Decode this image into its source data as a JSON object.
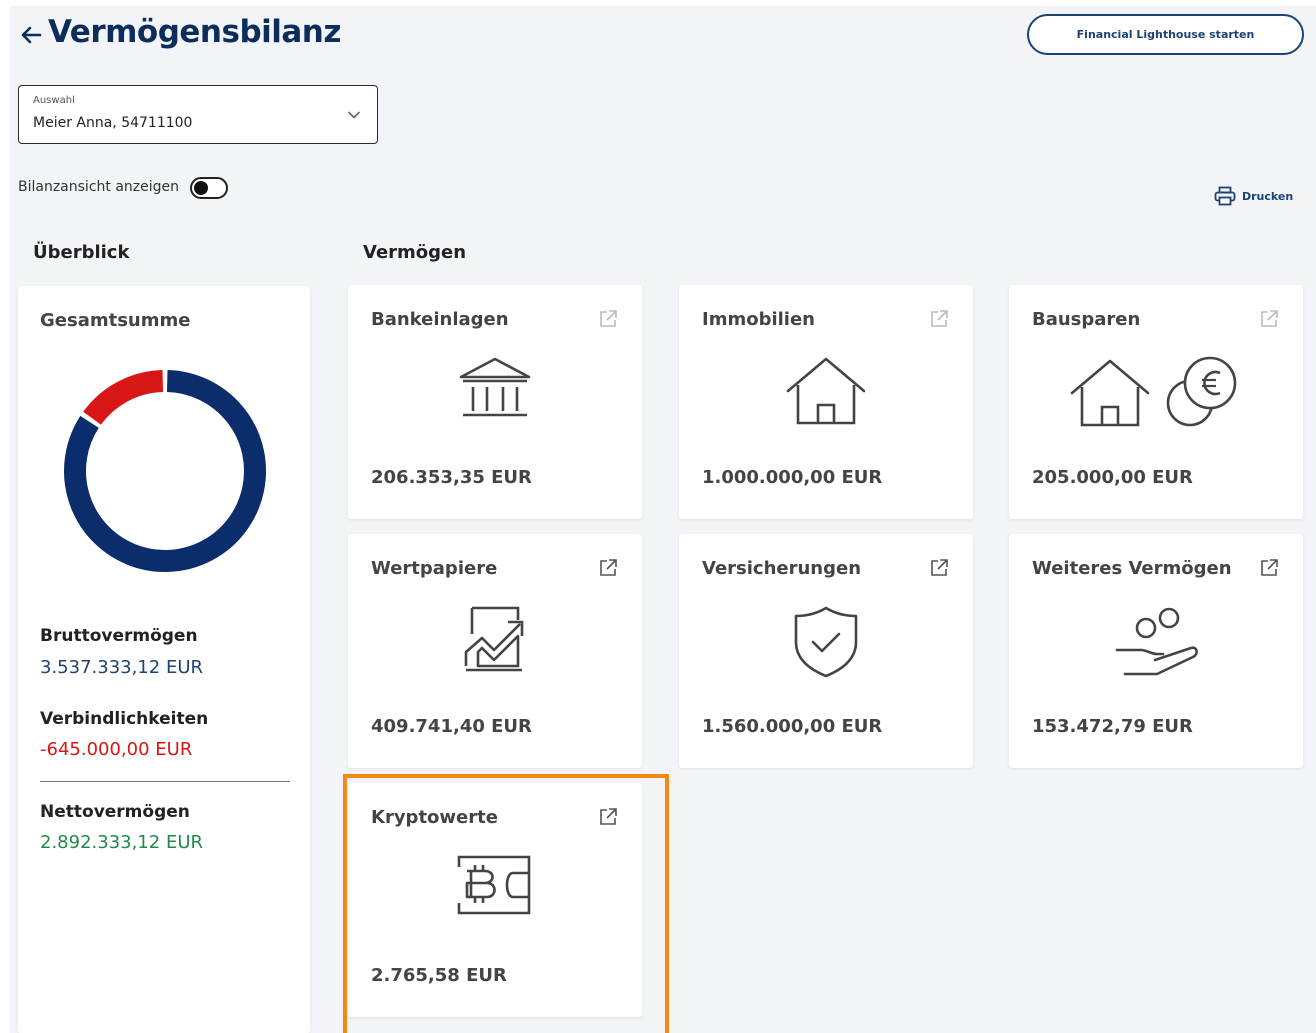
{
  "header": {
    "title": "Vermögensbilanz",
    "lighthouse_button": "Financial Lighthouse starten"
  },
  "selection": {
    "label": "Auswahl",
    "value": "Meier Anna, 54711100"
  },
  "toggle": {
    "label": "Bilanzansicht anzeigen",
    "checked": false
  },
  "print": {
    "label": "Drucken"
  },
  "sections": {
    "overview": "Überblick",
    "assets": "Vermögen"
  },
  "summary": {
    "title": "Gesamtsumme",
    "gross_label": "Bruttovermögen",
    "gross_value": "3.537.333,12 EUR",
    "liabilities_label": "Verbindlichkeiten",
    "liabilities_value": "-645.000,00 EUR",
    "net_label": "Nettovermögen",
    "net_value": "2.892.333,12 EUR"
  },
  "chart_data": {
    "type": "pie",
    "categories": [
      "Bruttovermögen",
      "Verbindlichkeiten"
    ],
    "values": [
      3537333.12,
      645000.0
    ],
    "colors": [
      "#0c2d6b",
      "#d81616"
    ]
  },
  "assets": [
    {
      "name": "Bankeinlagen",
      "value": "206.353,35 EUR",
      "icon": "bank-icon"
    },
    {
      "name": "Immobilien",
      "value": "1.000.000,00 EUR",
      "icon": "house-icon"
    },
    {
      "name": "Bausparen",
      "value": "205.000,00 EUR",
      "icon": "house-euro-icon"
    },
    {
      "name": "Wertpapiere",
      "value": "409.741,40 EUR",
      "icon": "securities-chart-icon"
    },
    {
      "name": "Versicherungen",
      "value": "1.560.000,00 EUR",
      "icon": "shield-check-icon"
    },
    {
      "name": "Weiteres Vermögen",
      "value": "153.472,79 EUR",
      "icon": "hand-coins-icon"
    },
    {
      "name": "Kryptowerte",
      "value": "2.765,58 EUR",
      "icon": "bitcoin-wallet-icon"
    }
  ],
  "colors": {
    "brand": "#0c2d5b",
    "negative": "#d81616",
    "positive": "#1f8a4c",
    "highlight": "#f08a14"
  }
}
